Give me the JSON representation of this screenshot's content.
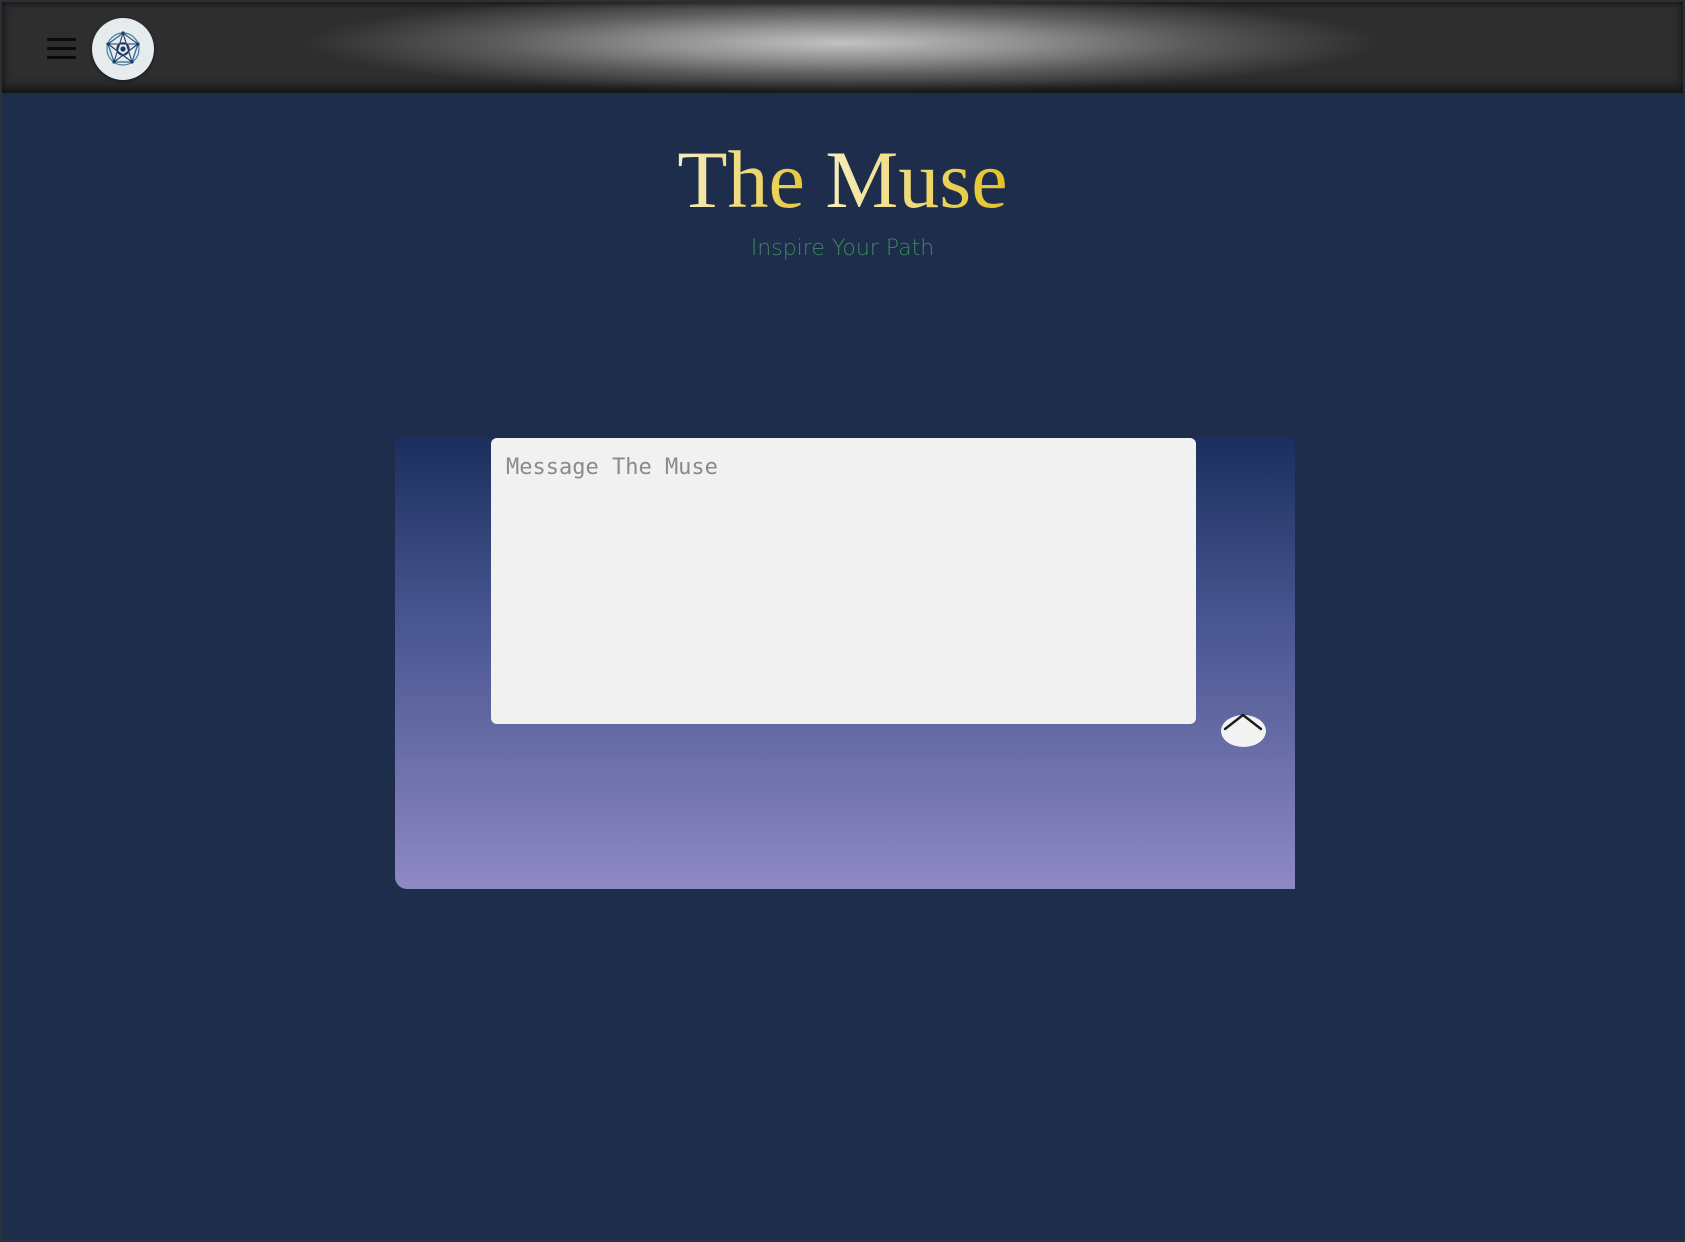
{
  "header": {
    "menu_icon": "hamburger-menu-icon",
    "logo_icon": "geometric-star-logo-icon"
  },
  "main": {
    "title_part1": "The ",
    "title_part2": "Muse",
    "subtitle": "Inspire Your Path"
  },
  "composer": {
    "placeholder": "Message The Muse",
    "value": "",
    "send_icon": "chevron-up-icon"
  },
  "colors": {
    "page_background": "#1d2d4b",
    "title_gold": "#e2c222",
    "subtitle_green": "#3d8a5e",
    "panel_gradient_top": "#1b2f5e",
    "panel_gradient_bottom": "#8f89c5"
  }
}
